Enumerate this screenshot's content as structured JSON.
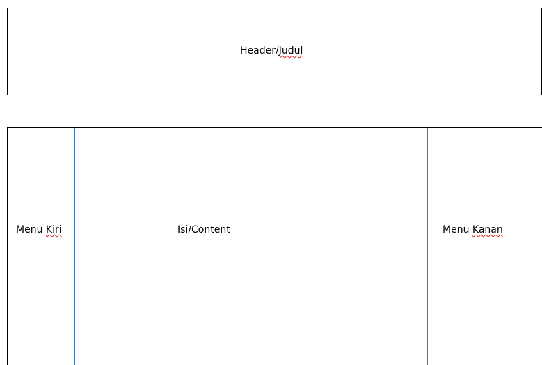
{
  "header": {
    "label_main": "Header/",
    "label_flagged": "Judul"
  },
  "layout": {
    "left_menu": {
      "label_main": "Menu ",
      "label_flagged": "Kiri"
    },
    "content": {
      "label": "Isi/Content"
    },
    "right_menu": {
      "label_main": "Menu ",
      "label_flagged": "Kanan"
    }
  },
  "colors": {
    "border": "#000000",
    "divider": "#4a76b8",
    "spellcheck_underline": "#e02020"
  }
}
